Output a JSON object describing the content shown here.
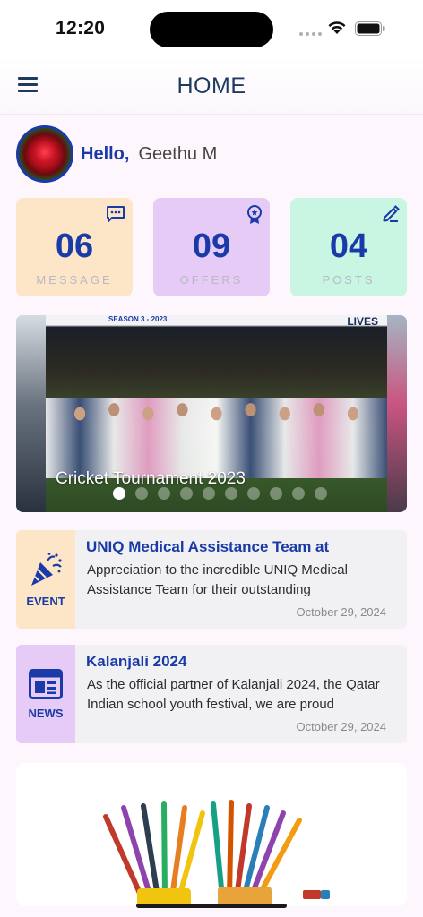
{
  "status_bar": {
    "time": "12:20"
  },
  "header": {
    "title": "HOME",
    "menu_icon": "hamburger-menu-icon"
  },
  "greeting": {
    "hello": "Hello,",
    "name": "Geethu M"
  },
  "stats": [
    {
      "count": "06",
      "label": "MESSAGE",
      "icon": "chat-icon",
      "color": "#fde6c8"
    },
    {
      "count": "09",
      "label": "OFFERS",
      "icon": "badge-icon",
      "color": "#e6cbf7"
    },
    {
      "count": "04",
      "label": "POSTS",
      "icon": "edit-icon",
      "color": "#c9f5e3"
    }
  ],
  "carousel": {
    "caption": "Cricket Tournament 2023",
    "banner_left": "SEASON 3 - 2023",
    "banner_right": "LIVES",
    "slide_count": 10,
    "active_index": 0
  },
  "feed": [
    {
      "type": "EVENT",
      "icon": "party-popper-icon",
      "title": "UNIQ Medical Assistance Team at",
      "body": "Appreciation to the incredible UNIQ Medical Assistance Team for their outstanding",
      "date": "October 29, 2024"
    },
    {
      "type": "NEWS",
      "icon": "newspaper-icon",
      "title": "Kalanjali 2024",
      "body": "As the official partner of Kalanjali 2024, the Qatar Indian school youth festival, we are proud",
      "date": "October 29, 2024"
    }
  ],
  "colors": {
    "accent": "#1a3aa8",
    "header_text": "#1d3a5f"
  }
}
